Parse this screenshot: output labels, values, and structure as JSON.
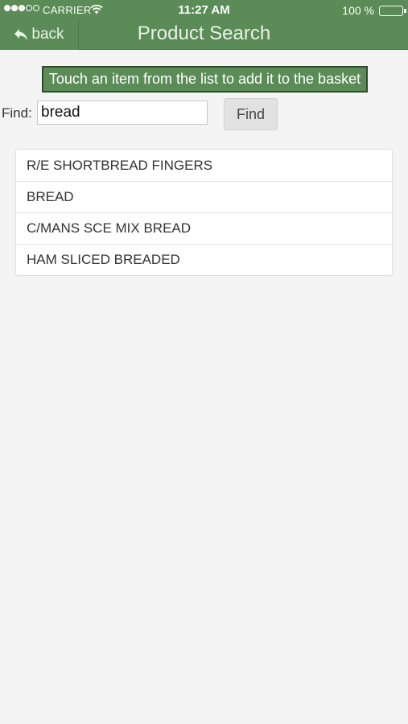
{
  "status_bar": {
    "carrier": "CARRIER",
    "time": "11:27 AM",
    "battery": "100 %",
    "icons": [
      "signal-dots-icon",
      "wifi-icon",
      "battery-icon"
    ]
  },
  "header": {
    "back_label": "back",
    "back_icon": "reply-arrow-icon",
    "title": "Product Search",
    "color": "#5b8c57"
  },
  "instruction": "Touch an item from the list to add it to the basket",
  "search": {
    "label": "Find:",
    "value": "bread",
    "button_label": "Find"
  },
  "results": [
    {
      "label": "R/E SHORTBREAD FINGERS"
    },
    {
      "label": "BREAD"
    },
    {
      "label": "C/MANS SCE MIX BREAD"
    },
    {
      "label": "HAM SLICED BREADED"
    }
  ]
}
